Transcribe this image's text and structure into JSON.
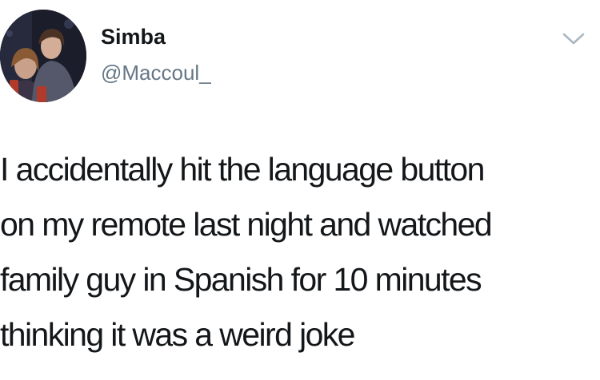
{
  "tweet": {
    "author": {
      "display_name": "Simba",
      "handle": "@Maccoul_",
      "avatar_icon": "profile-photo"
    },
    "menu_icon": "chevron-down-icon",
    "text": "I accidentally hit the language button\non my remote last night and watched\nfamily guy in Spanish for 10 minutes\nthinking it was a weird joke"
  }
}
